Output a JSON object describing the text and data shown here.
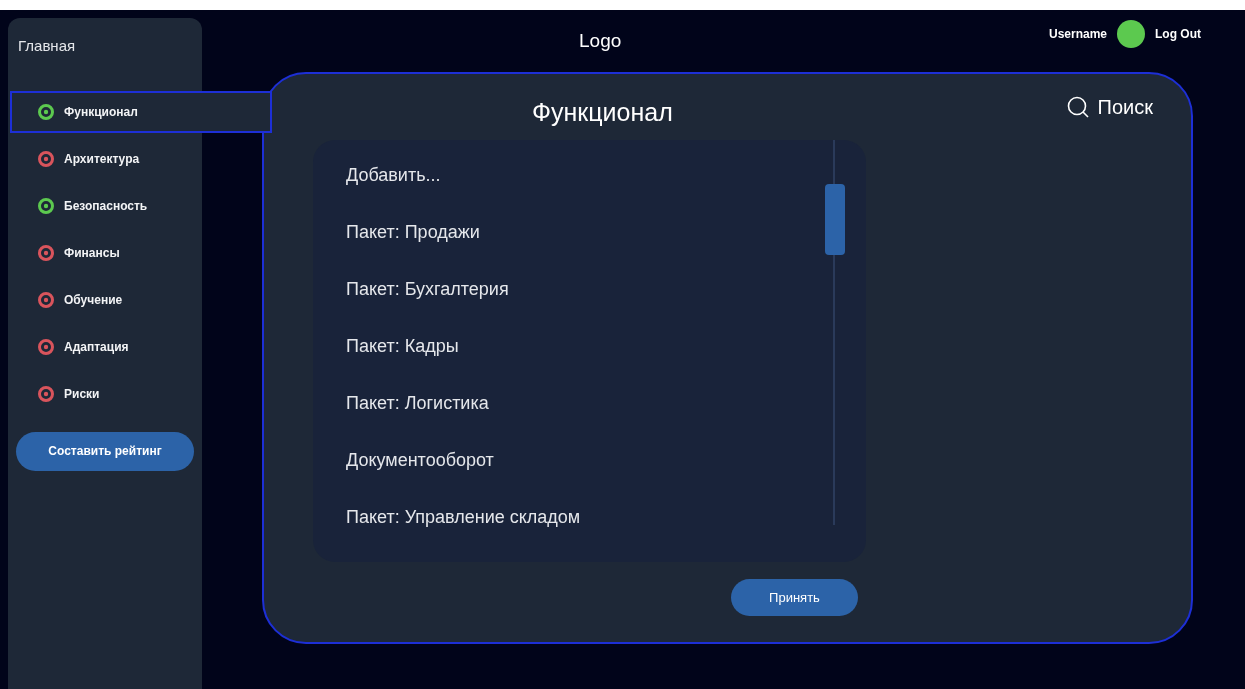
{
  "sidebar": {
    "home": "Главная",
    "items": [
      {
        "label": "Функционал",
        "selected": true,
        "color": "#5cc94f"
      },
      {
        "label": "Архитектура",
        "selected": false,
        "color": "#d9545c"
      },
      {
        "label": "Безопасность",
        "selected": false,
        "color": "#5cc94f"
      },
      {
        "label": "Финансы",
        "selected": false,
        "color": "#d9545c"
      },
      {
        "label": "Обучение",
        "selected": false,
        "color": "#d9545c"
      },
      {
        "label": "Адаптация",
        "selected": false,
        "color": "#d9545c"
      },
      {
        "label": "Риски",
        "selected": false,
        "color": "#d9545c"
      }
    ],
    "button": "Составить рейтинг"
  },
  "header": {
    "logo": "Logo",
    "username": "Username",
    "logout": "Log Out"
  },
  "panel": {
    "title": "Функционал",
    "search": "Поиск",
    "list": [
      "Добавить...",
      "Пакет: Продажи",
      "Пакет: Бухгалтерия",
      "Пакет: Кадры",
      "Пакет: Логистика",
      "Документооборот",
      "Пакет: Управление складом"
    ],
    "accept": "Принять"
  }
}
